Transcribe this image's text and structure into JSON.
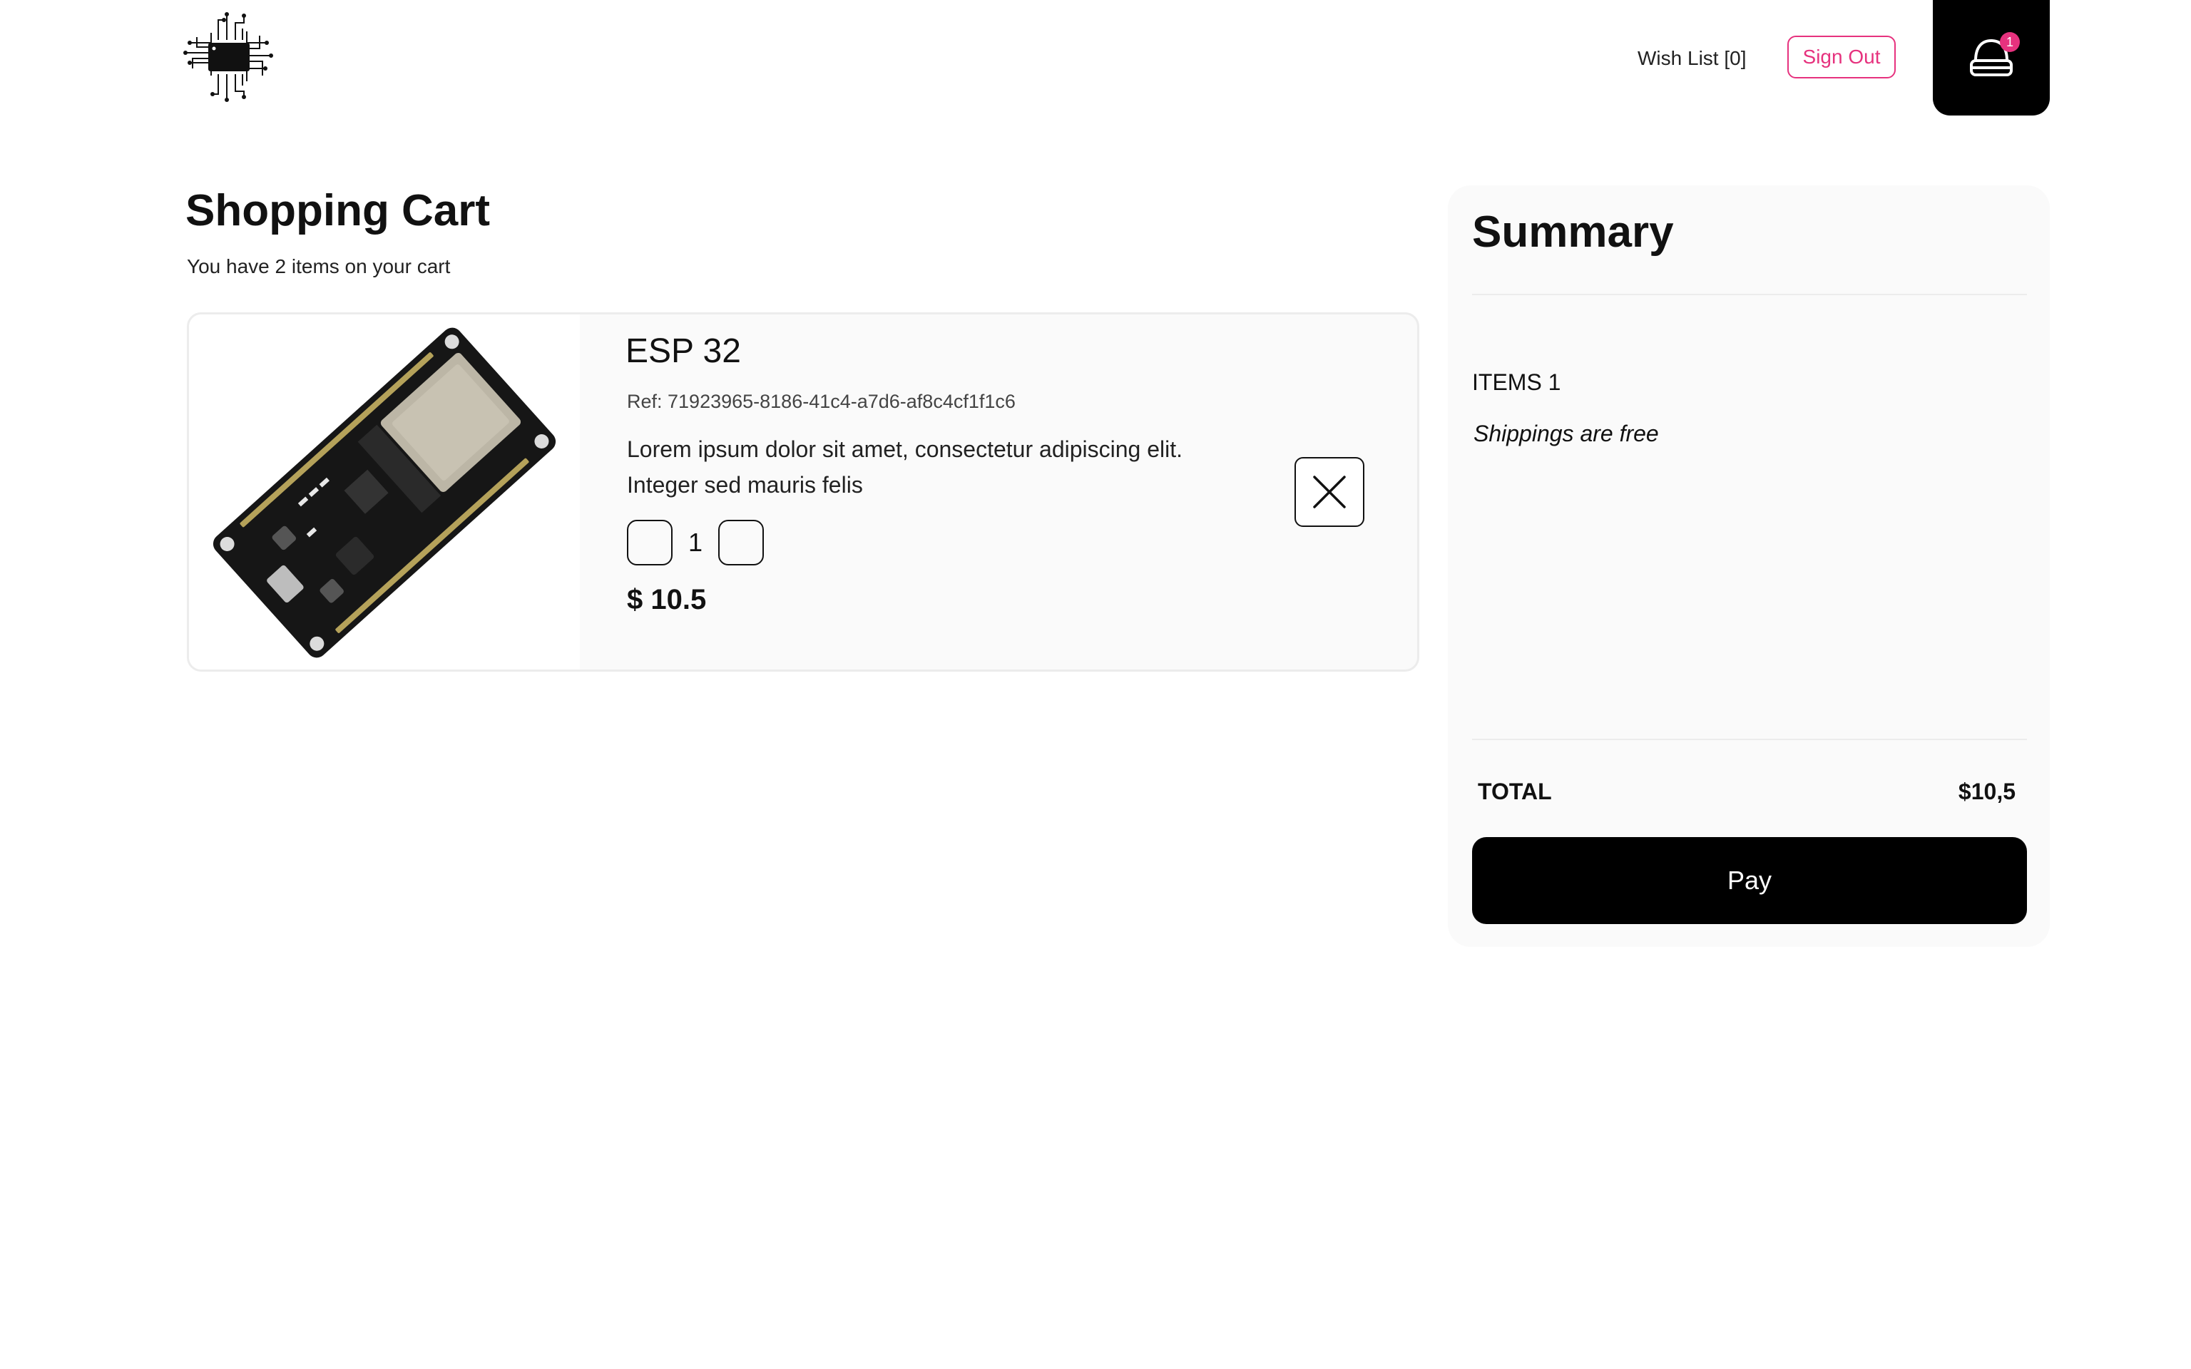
{
  "header": {
    "logo_icon": "circuit-chip-icon",
    "wishlist_label": "Wish List [0]",
    "signout_label": "Sign Out",
    "cart_icon": "shopping-bag-icon",
    "cart_count": "1"
  },
  "cart": {
    "title": "Shopping Cart",
    "subtitle": "You have 2 items on your cart",
    "items": [
      {
        "image_icon": "esp32-board-image",
        "name": "ESP 32",
        "ref": "Ref: 71923965-8186-41c4-a7d6-af8c4cf1f1c6",
        "description": "Lorem ipsum dolor sit amet, consectetur adipiscing elit. Integer sed mauris felis",
        "quantity": "1",
        "price": "$ 10.5",
        "remove_icon": "close-icon"
      }
    ]
  },
  "summary": {
    "title": "Summary",
    "items_label": "ITEMS 1",
    "shipping_note": "Shippings are free",
    "total_label": "TOTAL",
    "total_value": "$10,5",
    "pay_label": "Pay"
  },
  "colors": {
    "accent": "#e6327e",
    "dark": "#000000",
    "panel": "#fafafa"
  }
}
